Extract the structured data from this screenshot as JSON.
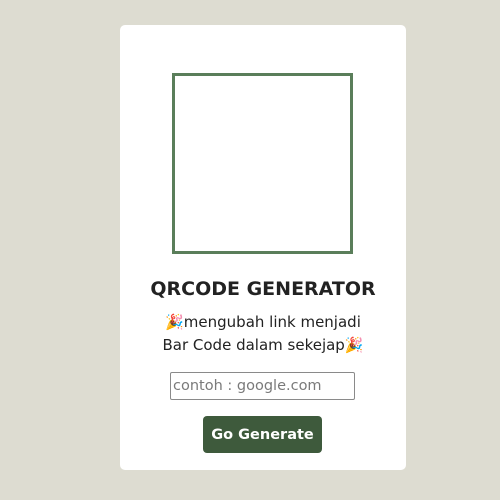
{
  "qr": {
    "frame_color": "#5a7e5a"
  },
  "heading": {
    "title": "QRCODE GENERATOR",
    "subtitle": "🎉mengubah link menjadi Bar Code dalam sekejap🎉"
  },
  "form": {
    "url_value": "",
    "url_placeholder": "contoh : google.com",
    "generate_label": "Go Generate"
  },
  "colors": {
    "background": "#dddcd1",
    "card": "#ffffff",
    "button": "#3e5a3c"
  }
}
